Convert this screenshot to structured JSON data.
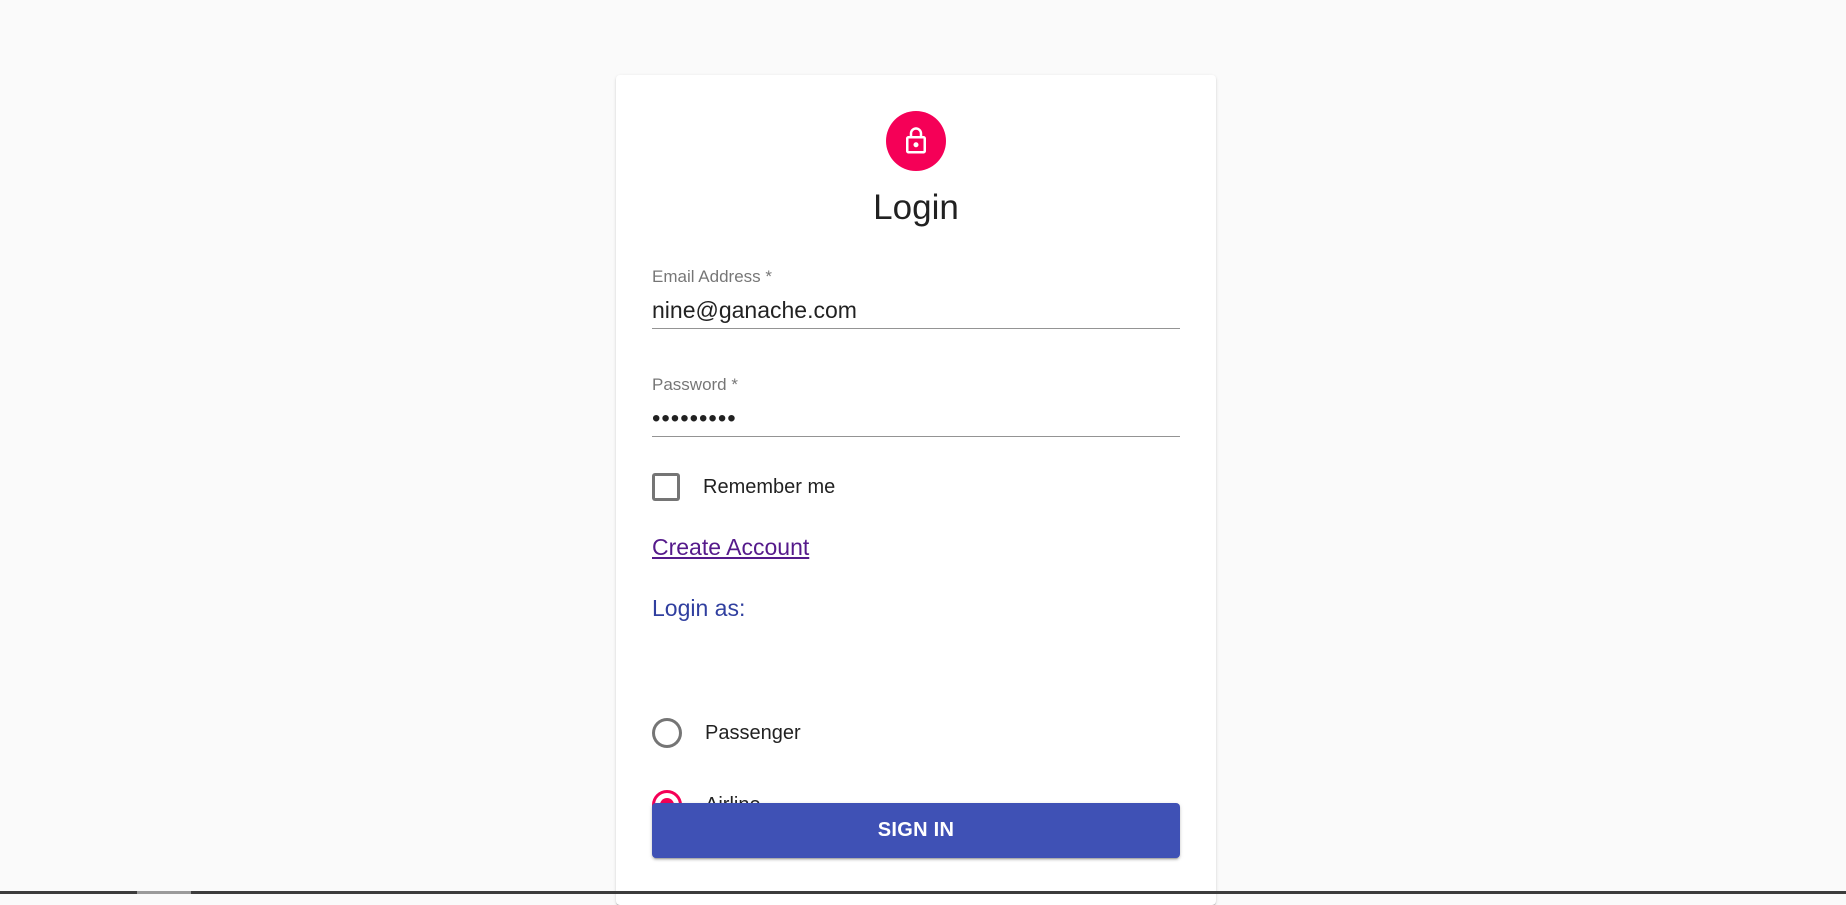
{
  "form": {
    "title": "Login",
    "icon": "lock-icon",
    "email": {
      "label": "Email Address *",
      "value": "nine@ganache.com"
    },
    "password": {
      "label": "Password *",
      "value": "•••••••••"
    },
    "remember": {
      "label": "Remember me",
      "checked": false
    },
    "create_account_label": "Create Account",
    "login_as": {
      "legend": "Login as:",
      "options": [
        {
          "label": "Passenger",
          "selected": false
        },
        {
          "label": "Airline",
          "selected": true
        }
      ]
    },
    "submit_label": "SIGN IN"
  },
  "colors": {
    "accent": "#f50057",
    "primary": "#3f51b5",
    "link": "#551a8b",
    "legend": "#303f9f",
    "background": "#fafafa"
  }
}
